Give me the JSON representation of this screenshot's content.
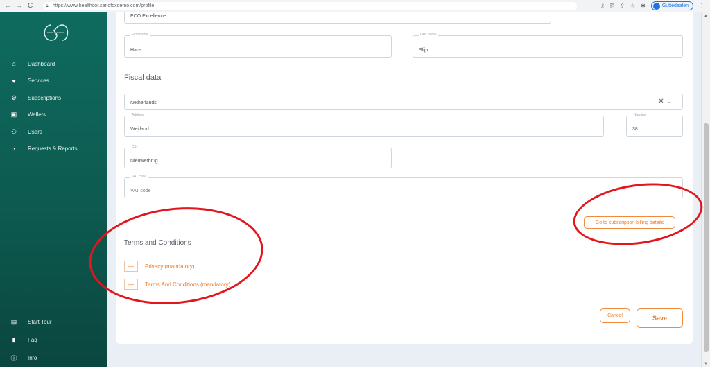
{
  "browser": {
    "url": "https://www.healthcor.sandfoxdemo.com/profile",
    "profile_label": "Guttedaalen",
    "nav_icons": [
      "back-icon",
      "forward-icon",
      "reload-icon"
    ]
  },
  "sidebar": {
    "items": [
      {
        "label": "Dashboard",
        "icon": "home-icon"
      },
      {
        "label": "Services",
        "icon": "heart-icon"
      },
      {
        "label": "Subscriptions",
        "icon": "settings-icon"
      },
      {
        "label": "Wallets",
        "icon": "bank-icon"
      },
      {
        "label": "Users",
        "icon": "users-icon"
      },
      {
        "label": "Requests & Reports",
        "icon": "report-icon"
      }
    ],
    "bottom_items": [
      {
        "label": "Start Tour",
        "icon": "tour-icon"
      },
      {
        "label": "Faq",
        "icon": "bookmark-icon"
      },
      {
        "label": "Info",
        "icon": "info-icon"
      }
    ]
  },
  "form": {
    "company_field_value": "ECO Excellence",
    "first_name": {
      "label": "First name",
      "value": "Hans"
    },
    "last_name": {
      "label": "Last name",
      "value": "Slijp"
    },
    "fiscal_title": "Fiscal data",
    "country": {
      "value": "Netherlands",
      "clear_glyph": "✕",
      "chevron_glyph": "⌄"
    },
    "address": {
      "label": "Address",
      "value": "Weijland"
    },
    "number": {
      "label": "Number",
      "value": "38"
    },
    "city": {
      "label": "City",
      "value": "Nieuwerbrug"
    },
    "vat": {
      "label": "VAT code",
      "placeholder": "VAT code"
    },
    "subscription_button": "Go to subscription billing details",
    "terms_title": "Terms and Conditions",
    "terms": [
      {
        "label": "Privacy (mandatory)"
      },
      {
        "label": "Terms And Conditions (mandatory)"
      }
    ],
    "cancel_label": "Cancel",
    "save_label": "Save"
  },
  "colors": {
    "sidebar": "#0f6b5f",
    "accent": "#f07a24",
    "annotation": "#e3161e"
  }
}
